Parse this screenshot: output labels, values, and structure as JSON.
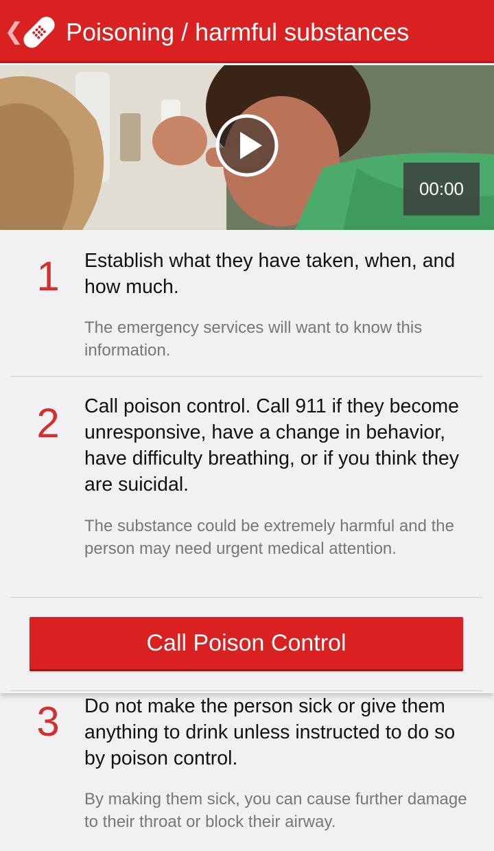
{
  "appbar": {
    "title": "Poisoning / harmful substances",
    "back_icon": "chevron-left-icon",
    "app_icon": "bandage-icon",
    "color": "#d92121"
  },
  "video": {
    "time": "00:00",
    "play_icon": "play-icon"
  },
  "steps": [
    {
      "number": "1",
      "title": "Establish what they have taken, when, and how much.",
      "description": "The emergency services will want to know this information."
    },
    {
      "number": "2",
      "title": "Call poison control. Call 911 if they become unresponsive, have a change in behavior, have difficulty breathing, or if you think they are suicidal.",
      "description": "The substance could be extremely harmful and the person may need urgent medical attention."
    },
    {
      "number": "3",
      "title": "Do not make the person sick or give them anything to drink unless instructed to do so by poison control.",
      "description": "By making them sick, you can cause further damage to their throat or block their airway."
    }
  ],
  "call_button": {
    "label": "Call Poison Control"
  },
  "colors": {
    "accent": "#d92121",
    "step_number": "#d32f2f",
    "description_text": "#777777"
  }
}
